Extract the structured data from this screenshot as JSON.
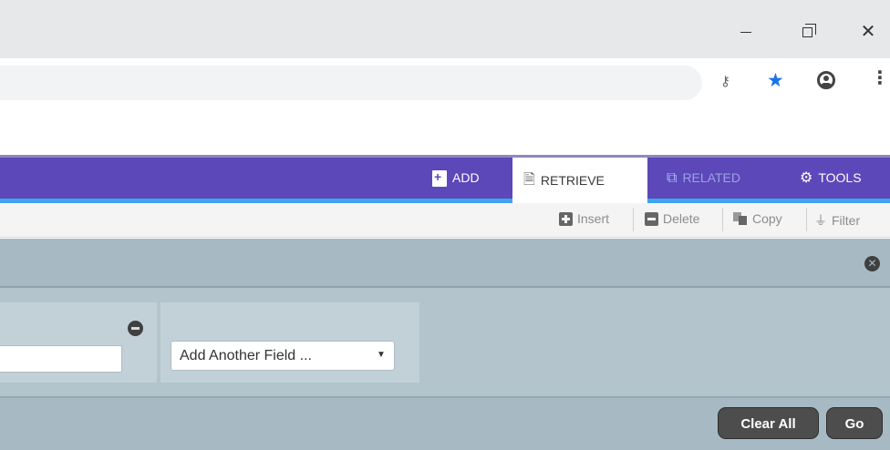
{
  "browser": {
    "window_controls": {
      "minimize_icon": "minimize-icon",
      "maximize_icon": "restore-icon",
      "close_icon": "close-icon",
      "close_glyph": "✕"
    },
    "toolbar_icons": {
      "key_glyph": "⚷",
      "star_glyph": "★",
      "menu_glyph": "⋮"
    }
  },
  "header": {
    "items": [
      {
        "label": "ADD",
        "icon": "add-icon"
      },
      {
        "label": "RETRIEVE",
        "icon": "retrieve-icon"
      },
      {
        "label": "RELATED",
        "icon": "related-icon"
      },
      {
        "label": "TOOLS",
        "icon": "gear-icon"
      }
    ],
    "colors": {
      "bar": "#5c48b8",
      "accent_line": "#3ea4f0"
    }
  },
  "toolbar": {
    "insert_label": "Insert",
    "delete_label": "Delete",
    "copy_label": "Copy",
    "filter_label": "Filter"
  },
  "search_panel": {
    "field_value": "",
    "add_field_select": "Add Another Field ...",
    "clear_all_label": "Clear All",
    "go_label": "Go",
    "close_glyph": "✕"
  }
}
